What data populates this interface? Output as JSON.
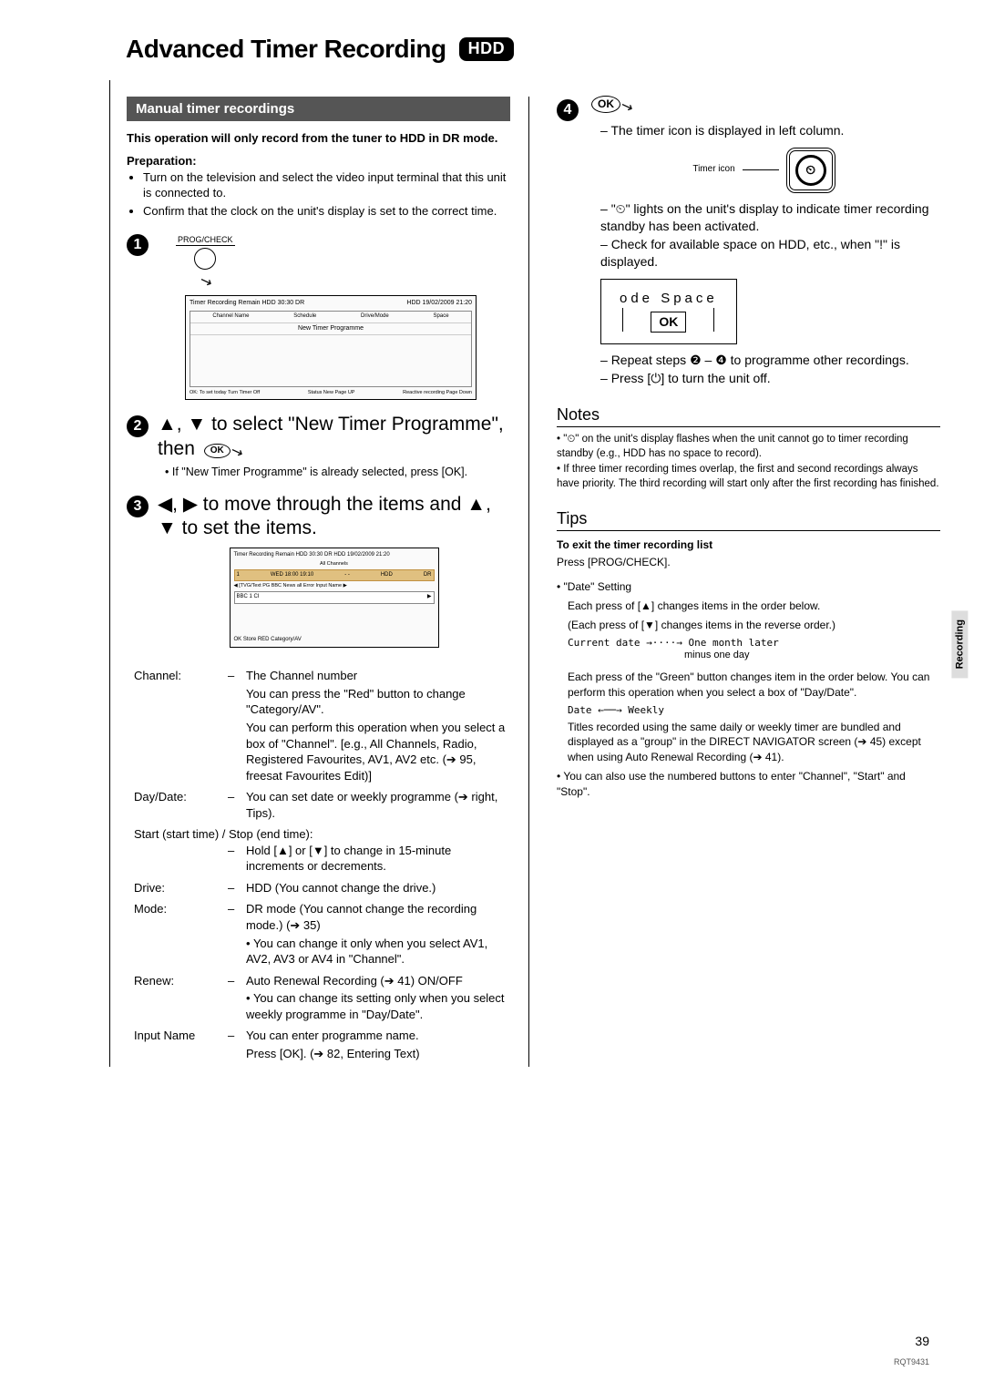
{
  "title": "Advanced Timer Recording",
  "hdd_badge": "HDD",
  "section_header": "Manual timer recordings",
  "intro_bold": "This operation will only record from the tuner to HDD in DR mode.",
  "preparation_label": "Preparation:",
  "preparation": [
    "Turn on the television and select the video input terminal that this unit is connected to.",
    "Confirm that the clock on the unit's display is set to the correct time."
  ],
  "prog_check_label": "PROG/CHECK",
  "screenshot1": {
    "top_left": "Timer Recording   Remain HDD  30:30 DR",
    "top_right": "HDD 19/02/2009 21:20",
    "cols": [
      "Channel Name",
      "Schedule",
      "Drive/Mode",
      "Space"
    ],
    "newprog": "New Timer Programme",
    "bottom_left": "OK: To set today     Turn Timer Off",
    "bottom_mid": "Status     New     Page UP",
    "bottom_right": "Reactive recording     Page Down"
  },
  "step2_text": "▲, ▼ to select \"New Timer Programme\", then",
  "ok_label": "OK",
  "step2_sub": "If \"New Timer Programme\" is already selected, press [OK].",
  "step3_text": "◀, ▶ to move through the items and ▲, ▼ to set the items.",
  "screenshot2": {
    "top": "Timer Recording   Remain HDD 30:30 DR           HDD 19/02/2009 21:20",
    "row_sel": [
      "1",
      "WED 18:00 19:10",
      "- -",
      "HDD",
      "DR",
      ""
    ],
    "tvg": "◀ [TVG/Text PG   BBC News all Error            Input Name ▶",
    "inputname": [
      "BBC 1 CI",
      "▶"
    ],
    "bottom": "OK Store     RED Category/AV"
  },
  "fields": {
    "channel_label": "Channel:",
    "channel_dash": "–",
    "channel_val": "The Channel number",
    "channel_sub1": "You can press the \"Red\" button to change \"Category/AV\".",
    "channel_sub2": "You can perform this operation when you select a box of \"Channel\". [e.g., All Channels, Radio, Registered Favourites, AV1, AV2 etc. (➔ 95, freesat Favourites Edit)]",
    "daydate_label": "Day/Date:",
    "daydate_val": "You can set date or weekly programme (➔ right, Tips).",
    "startstop": "Start (start time) / Stop (end time):",
    "startstop_val": "Hold [▲] or [▼] to change in 15-minute increments or decrements.",
    "drive_label": "Drive:",
    "drive_val": "HDD (You cannot change the drive.)",
    "mode_label": "Mode:",
    "mode_val": "DR mode (You cannot change the recording mode.) (➔ 35)",
    "mode_sub": "You can change it only when you select AV1, AV2, AV3 or AV4 in \"Channel\".",
    "renew_label": "Renew:",
    "renew_val": "Auto Renewal Recording (➔ 41) ON/OFF",
    "renew_sub": "You can change its setting only when you select weekly programme in \"Day/Date\".",
    "inputname_label": "Input Name",
    "inputname_val": "You can enter programme name.",
    "inputname_sub": "Press [OK]. (➔ 82, Entering Text)"
  },
  "right": {
    "step4_a": "The timer icon is displayed in left column.",
    "timer_icon_label": "Timer icon",
    "step4_b": "\"⏲\" lights on the unit's display to indicate timer recording standby has been activated.",
    "step4_c": "Check for available space on HDD, etc., when \"!\" is displayed.",
    "code_top": "ode     Space",
    "code_ok": "OK",
    "step4_d_pre": "Repeat steps ❷ – ❹ to programme other recordings.",
    "step4_e": "Press [⏻] to turn the unit off.",
    "notes_head": "Notes",
    "notes": [
      "\"⏲\" on the unit's display flashes when the unit cannot go to timer recording standby (e.g., HDD has no space to record).",
      "If three timer recording times overlap, the first and second recordings always have priority. The third recording will start only after the first recording has finished."
    ],
    "tips_head": "Tips",
    "tips_exit_bold": "To exit the timer recording list",
    "tips_exit": "Press [PROG/CHECK].",
    "tips_date_head": "\"Date\" Setting",
    "tips_date1": "Each press of [▲] changes items in the order below.",
    "tips_date2": "(Each press of [▼] changes items in the reverse order.)",
    "tips_date3": "Current date →····→ One month later",
    "tips_date3b": "minus one day",
    "tips_green": "Each press of the \"Green\" button changes item in the order below. You can perform this operation when you select a box of \"Day/Date\".",
    "tips_dateweekly": "Date  ←──→  Weekly",
    "tips_group": "Titles recorded using the same daily or weekly timer are bundled and displayed as a \"group\" in the DIRECT NAVIGATOR screen (➔ 45) except when using Auto Renewal Recording (➔ 41).",
    "tips_numbered": "You can also use the numbered buttons to enter \"Channel\", \"Start\" and \"Stop\"."
  },
  "side_tab": "Recording",
  "page_num": "39",
  "doc_id": "RQT9431"
}
